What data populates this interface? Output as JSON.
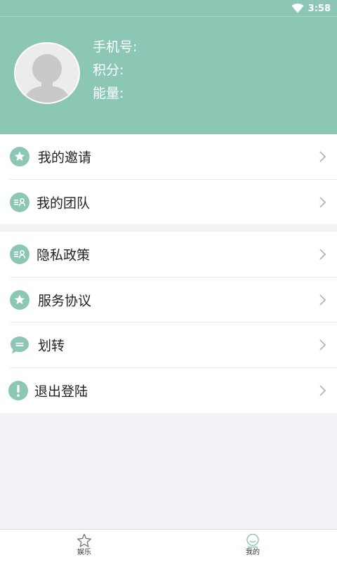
{
  "status_bar": {
    "time": "3:58",
    "icons": [
      "wifi-icon"
    ]
  },
  "profile": {
    "avatar_icon": "default-avatar-icon",
    "phone_label": "手机号:",
    "points_label": "积分:",
    "energy_label": "能量:"
  },
  "menu": {
    "group1": [
      {
        "label": "我的邀请",
        "icon": "star-icon"
      },
      {
        "label": "我的团队",
        "icon": "team-list-icon"
      }
    ],
    "group2": [
      {
        "label": "隐私政策",
        "icon": "team-list-icon"
      },
      {
        "label": "服务协议",
        "icon": "star-icon"
      },
      {
        "label": "划转",
        "icon": "chat-bubble-icon"
      },
      {
        "label": "退出登陆",
        "icon": "exclamation-icon"
      }
    ]
  },
  "bottom_nav": {
    "items": [
      {
        "label": "娱乐",
        "icon": "star-outline-icon",
        "active": false
      },
      {
        "label": "我的",
        "icon": "smiley-icon",
        "active": true
      }
    ]
  },
  "colors": {
    "accent": "#8bc7b4",
    "background": "#f4f2f7",
    "text": "#222222",
    "chevron": "#b5b5b5"
  }
}
